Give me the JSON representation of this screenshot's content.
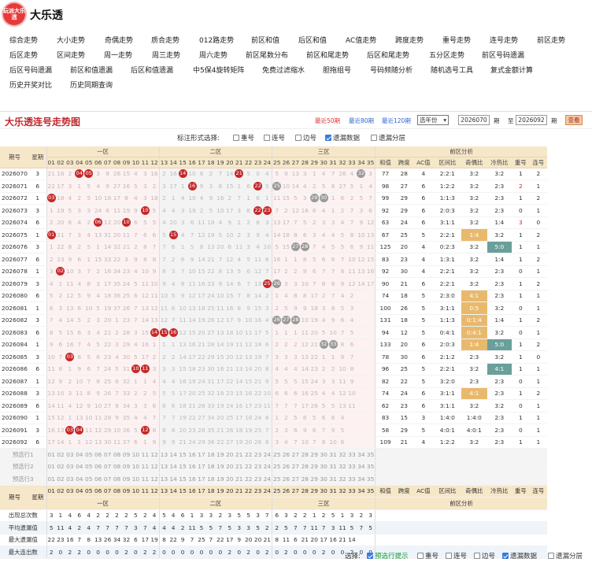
{
  "app": {
    "logo_text": "玩派大乐透",
    "title": "大乐透"
  },
  "nav": [
    [
      "综合走势",
      "大小走势",
      "奇偶走势",
      "质合走势",
      "012路走势",
      "前区和值",
      "后区和值",
      "AC值走势",
      "跨度走势",
      "重号走势",
      "连号走势",
      "前区走势"
    ],
    [
      "后区走势",
      "区间走势",
      "周一走势",
      "周三走势",
      "周六走势",
      "前区尾数分布",
      "前区和尾走势",
      "后区和尾走势",
      "五分区走势",
      "前区号码遗漏"
    ],
    [
      "后区号码遗漏",
      "前区和值遗漏",
      "后区和值遗漏",
      "中5保4旋转矩阵",
      "免费过滤缩水",
      "胆拖组号",
      "号码频随分析",
      "随机选号工具",
      "复式金额计算"
    ],
    [
      "历史开奖对比",
      "历史同期查询"
    ]
  ],
  "panel": {
    "title": "大乐透连号走势图",
    "last50": "最近50期",
    "last80": "最近80期",
    "last120": "最近120期",
    "year_select": "选年份",
    "from_issue": "2026070",
    "from_label": "期",
    "to_label": "至",
    "to_issue": "2026092",
    "to_suffix": "期",
    "query": "查看"
  },
  "marking": {
    "label": "标注形式选择:",
    "opts": [
      {
        "t": "重号",
        "on": false
      },
      {
        "t": "连号",
        "on": false
      },
      {
        "t": "边号",
        "on": false
      },
      {
        "t": "遗漏数据",
        "on": true
      },
      {
        "t": "遗漏分层",
        "on": false
      }
    ]
  },
  "table": {
    "h_issue": "期号",
    "h_week": "星期",
    "h_zone1": "一区",
    "h_zone2": "二区",
    "h_zone3": "三区",
    "h_front": "前区分析",
    "cols": [
      "和值",
      "跨度",
      "AC值",
      "区间比",
      "奇偶比",
      "冷热比",
      "重号",
      "连号"
    ],
    "h_issue2": "期号",
    "h_week2": "星期",
    "zone_front": "前区分析",
    "rows": [
      [
        "2026070",
        "3",
        "21 16 2 [04] [05] 3 8 26 15 4 3 16 | 2 16 [14] 10 8 2 7 14 [21] 5 0 4 | 5 9 13 3 1 4 7 26 4 [32] 3 5 8",
        "77",
        "28",
        "4",
        "2:2:1",
        "3:2",
        "3:2",
        "1",
        "2"
      ],
      [
        "2026071",
        "6",
        "22 17 3 1 5 4 9 27 16 5 3 2 | 3 17 1 [16] 9 3 8 15 1 6 [22] 5 | [25] 10 14 4 2 5 8 27 5 1 4 6 9",
        "98",
        "27",
        "6",
        "1:2:2",
        "3:2",
        "2:3",
        "2",
        "1"
      ],
      [
        "2026072",
        "1",
        "[03] 18 4 2 5 10 18 17 8 4 3 | 18 2 1 4 10 4 9 16 2 7 1 6 | 1 11 15 5 3 [29] [30] 1 6 2 5 7 10",
        "99",
        "29",
        "6",
        "1:1:3",
        "3:2",
        "2:3",
        "1",
        "2"
      ],
      [
        "2026073",
        "3",
        "1 19 5 3 3 24 6 11 19 9 [10] 5 4 | 4 3 19 2 5 10 17 3 8 [22] [23] 7 | 2 12 16 6 4 1 2 7 3 6 8 11",
        "92",
        "29",
        "6",
        "2:0:3",
        "3:2",
        "2:3",
        "0",
        "1"
      ],
      [
        "2026074",
        "6",
        "2 20 6 4 2 [06] 12 20 [10] 6 5 | 5 4 20 3 6 11 18 4 9 1 2 8 | 3 13 17 7 5 2 3 3 4 7 9 12",
        "63",
        "24",
        "6",
        "3:1:1",
        "3:2",
        "1:4",
        "3",
        "0"
      ],
      [
        "2026075",
        "1",
        "[01] 21 7 3 4 13 31 20 11 7 6 | 6 5 [15] 4 7 12 19 5 10 2 3 9 | 4 14 18 8 6 3 4 4 5 8 10 13",
        "67",
        "25",
        "5",
        "2:2:1",
        "1:4",
        "3:2",
        "1",
        "2"
      ],
      [
        "2026076",
        "3",
        "1 22 8 2 5 1 14 32 21 2 8 7 | 7 6 1 5 8 13 20 6 11 3 4 10 | 5 15 [27] [28] 7 4 5 5 6 9 11 14",
        "125",
        "20",
        "4",
        "0:2:3",
        "3:2",
        "5:0",
        "1",
        "1"
      ],
      [
        "2026077",
        "6",
        "2 23 9 6 1 15 33 22 3 9 8 | 8 7 2 6 9 14 21 7 12 4 5 11 | 6 16 1 1 8 5 6 6 7 10 12 15",
        "83",
        "23",
        "4",
        "1:3:1",
        "3:2",
        "1:4",
        "1",
        "2"
      ],
      [
        "2026078",
        "1",
        "3 [02] 10 3 7 2 16 34 23 4 10 | 9 8 3 7 10 15 22 8 13 5 6 12 | 7 17 2 2 9 6 7 7 8 11 13 16",
        "92",
        "30",
        "4",
        "2:2:1",
        "3:2",
        "2:3",
        "0",
        "1"
      ],
      [
        "2026079",
        "3",
        "4 1 11 4 8 3 17 35 24 5 11 | 10 9 4 8 11 16 23 9 14 6 7 13 | [25] [26] 3 3 10 7 8 8 9 12 14 17",
        "90",
        "21",
        "6",
        "2:2:1",
        "3:2",
        "2:3",
        "1",
        "2"
      ],
      [
        "2026080",
        "6",
        "5 2 12 5 9 4 18 36 25 6 12 | 11 10 5 9 12 17 24 10 15 7 8 14 | 2 1 4 8 8 17 2 7 4 2",
        "74",
        "18",
        "5",
        "2:3:0",
        "4:1",
        "2:3",
        "1",
        "1"
      ],
      [
        "2026081",
        "1",
        "6 3 13 6 10 5 19 37 26 7 13 | 12 11 6 10 13 18 25 11 16 8 9 15 | 3 2 5 9 9 18 3 8 5 3",
        "100",
        "26",
        "5",
        "3:1:1",
        "0:5",
        "3:2",
        "0",
        "1"
      ],
      [
        "2026082",
        "3",
        "7 4 14 5 2 3 20 1 23 7 14 | 13 12 7 11 14 19 26 12 17 9 10 16 | 4 [26] [27] [28] 10 19 4 9 6 4",
        "131",
        "18",
        "5",
        "1:1:3",
        "0:1:4",
        "1:4",
        "1",
        "2"
      ],
      [
        "2026083",
        "6",
        "8 5 15 6 3 4 21 2 28 3 15 | [14] [15] [16] 12 15 20 27 13 18 10 11 17 | 5 1 1 1 11 20 5 10 7 5",
        "94",
        "12",
        "5",
        "0:4:1",
        "0:4:1",
        "3:2",
        "0",
        "1"
      ],
      [
        "2026084",
        "1",
        "9 6 16 7 4 5 22 3 29 4 16 | 1 1 1 13 16 21 28 14 19 11 12 18 | 6 2 2 2 12 21 [32] [33] 8 6",
        "133",
        "20",
        "6",
        "2:0:3",
        "1:4",
        "5:0",
        "1",
        "2"
      ],
      [
        "2026085",
        "3",
        "10 7 [03] 8 5 6 23 4 30 5 17 | 2 2 2 14 17 22 29 15 20 12 13 19 | 7 3 3 3 13 22 1 1 9 7",
        "78",
        "30",
        "6",
        "2:1:2",
        "2:3",
        "3:2",
        "1",
        "0"
      ],
      [
        "2026086",
        "6",
        "11 8 1 9 6 7 24 5 31 [10] [11] | 3 3 3 15 18 23 30 16 21 13 14 20 | 8 4 4 4 14 23 2 2 10 8",
        "96",
        "25",
        "5",
        "2:2:1",
        "3:2",
        "4:1",
        "1",
        "1"
      ],
      [
        "2026087",
        "1",
        "12 9 2 10 7 8 25 6 32 1 1 | 4 4 4 16 19 24 31 17 22 14 15 21 | 9 5 5 5 15 24 3 3 11 9",
        "82",
        "22",
        "5",
        "3:2:0",
        "2:3",
        "2:3",
        "0",
        "1"
      ],
      [
        "2026088",
        "3",
        "13 10 3 11 8 9 26 7 33 2 2 | 5 5 5 17 20 25 32 18 23 15 16 22 | 10 6 6 6 16 25 4 4 12 10",
        "74",
        "24",
        "6",
        "3:1:1",
        "4:1",
        "2:3",
        "1",
        "2"
      ],
      [
        "2026089",
        "6",
        "14 11 4 12 9 10 27 8 34 3 3 | 6 6 6 18 21 26 33 19 24 16 17 23 | 11 7 7 7 17 26 5 5 13 11",
        "62",
        "23",
        "6",
        "3:1:1",
        "3:2",
        "3:2",
        "0",
        "1"
      ],
      [
        "2026090",
        "1",
        "15 12 1 13 10 11 28 9 35 4 4 | 7 7 7 19 22 27 34 20 25 17 18 24 | 6 1 2 5 8 5 6 8 4",
        "83",
        "15",
        "3",
        "1:4:0",
        "1:4:0",
        "2:3",
        "1",
        "1"
      ],
      [
        "2026091",
        "3",
        "16 13 [03] [04] 11 12 29 10 36 5 [12] | 8 8 8 20 23 28 35 21 26 18 19 25 | 7 2 3 6 9 6 7 9 5",
        "58",
        "29",
        "5",
        "4:0:1",
        "4:0:1",
        "2:3",
        "0",
        "1"
      ],
      [
        "2026092",
        "6",
        "17 14 1 1 12 13 30 11 37 6 1 | 9 9 9 21 24 29 36 22 27 19 20 26 | 8 3 4 7 10 7 8 10 6",
        "109",
        "21",
        "4",
        "1:2:2",
        "3:2",
        "2:3",
        "1",
        "1"
      ]
    ],
    "pred_labels": [
      "预选行1",
      "预选行2",
      "预选行3"
    ],
    "nums": [
      "01",
      "02",
      "03",
      "04",
      "05",
      "06",
      "07",
      "08",
      "09",
      "10",
      "11",
      "12",
      "13",
      "14",
      "15",
      "16",
      "17",
      "18",
      "19",
      "20",
      "21",
      "22",
      "23",
      "24",
      "25",
      "26",
      "27",
      "28",
      "29",
      "30",
      "31",
      "32",
      "33",
      "34",
      "35"
    ],
    "stat_rows": [
      {
        "label": "出现总次数",
        "vals": "3 1 4 6 4 2 2 2 2 5 2 | 4 5 4 6 1 3 3 2 3 5 5 | 3 7 6 3 2 2 1 2 5 1 3 2 3"
      },
      {
        "label": "平均遗漏值",
        "vals": "5 11 4 2 4 7 7 7 7 3 7 | 4 4 4 2 11 5 5 7 5 3 3 | 5 2 2 5 7 7 11 7 3 11 5 7 5"
      },
      {
        "label": "最大遗漏值",
        "vals": "22 23 16 7 8 13 26 34 32 6 17 19 | 8 22 9 7 25 7 22 17 9 20 20 | 21 8 11 6 21 20 17 16 21 14"
      },
      {
        "label": "最大连出数",
        "vals": "2 0 2 2 0 0 0 0 2 0 2 | 2 0 0 0 0 0 0 0 2 0 2 | 0 2 0 2 0 0 0 2 0 0 2 0 0"
      }
    ]
  },
  "footer": {
    "label": "选择:",
    "opts": [
      {
        "t": "预选行提示",
        "on": true,
        "g": true
      },
      {
        "t": "重号",
        "on": false
      },
      {
        "t": "连号",
        "on": false
      },
      {
        "t": "边号",
        "on": false
      },
      {
        "t": "遗漏数据",
        "on": true
      },
      {
        "t": "遗漏分层",
        "on": false
      }
    ]
  }
}
